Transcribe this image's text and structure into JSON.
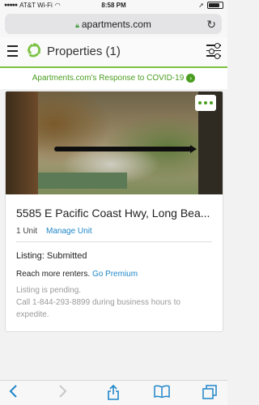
{
  "status_bar": {
    "carrier": "AT&T Wi-Fi",
    "time": "8:58 PM"
  },
  "browser": {
    "url": "apartments.com"
  },
  "header": {
    "title": "Properties (1)"
  },
  "banner": {
    "text": "Apartments.com's Response to COVID-19"
  },
  "property": {
    "address": "5585 E Pacific Coast Hwy, Long Bea...",
    "units": "1 Unit",
    "manage_label": "Manage Unit",
    "listing_status": "Listing: Submitted",
    "reach_text": "Reach more renters.",
    "premium_label": "Go Premium",
    "pending_note": "Listing is pending.",
    "call_note": "Call 1-844-293-8899 during business hours to expedite."
  },
  "colors": {
    "brand_green": "#4a9d1f",
    "link_blue": "#1f86c8"
  }
}
